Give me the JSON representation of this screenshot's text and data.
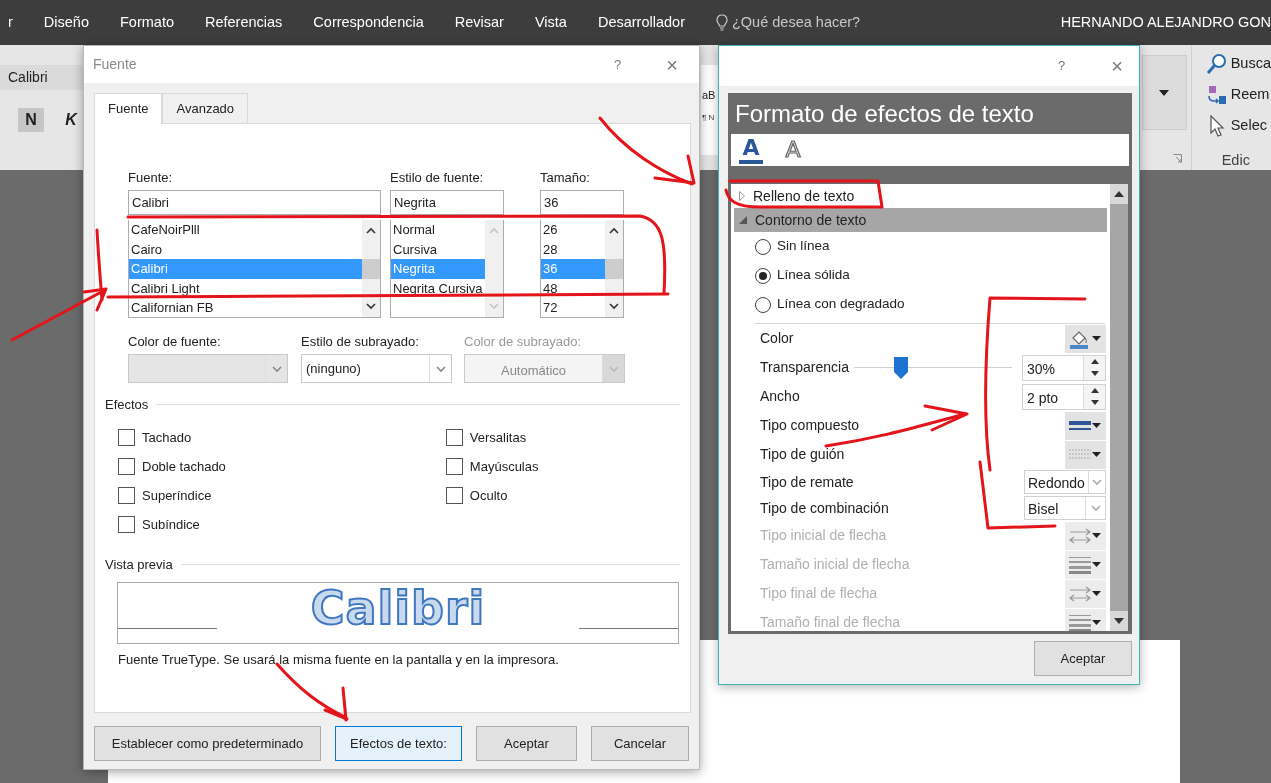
{
  "ribbon": {
    "tabs": [
      {
        "label": "r"
      },
      {
        "label": "Diseño"
      },
      {
        "label": "Formato"
      },
      {
        "label": "Referencias"
      },
      {
        "label": "Correspondencia"
      },
      {
        "label": "Revisar"
      },
      {
        "label": "Vista"
      },
      {
        "label": "Desarrollador"
      }
    ],
    "tell_me": {
      "placeholder": "¿Qué desea hacer?"
    },
    "user": "HERNANDO ALEJANDRO GON",
    "font_name": "Calibri",
    "bold": "N",
    "italic": "K",
    "styles_fragment": "aB",
    "paragraph_fragment": "¶ N",
    "editing": {
      "items": [
        {
          "kind": "find",
          "label": "Busca"
        },
        {
          "kind": "replace",
          "label": "Reem"
        },
        {
          "kind": "select",
          "label": "Selec"
        }
      ],
      "group_label": "Edic"
    }
  },
  "font_dialog": {
    "title": "Fuente",
    "help": "?",
    "close": "×",
    "tabs": [
      {
        "label": "Fuente",
        "selected": true
      },
      {
        "label": "Avanzado",
        "selected": false
      }
    ],
    "pickers": [
      {
        "label": "Fuente:",
        "value": "Calibri",
        "scrollbar_disabled": false,
        "items": [
          {
            "text": "CafeNoirPlll",
            "selected": false
          },
          {
            "text": "Cairo",
            "selected": false
          },
          {
            "text": "Calibri",
            "selected": true
          },
          {
            "text": "Calibri Light",
            "selected": false
          },
          {
            "text": "Californian FB",
            "selected": false
          }
        ]
      },
      {
        "label": "Estilo de fuente:",
        "value": "Negrita",
        "scrollbar_disabled": true,
        "items": [
          {
            "text": "Normal",
            "selected": false
          },
          {
            "text": "Cursiva",
            "selected": false
          },
          {
            "text": "Negrita",
            "selected": true
          },
          {
            "text": "Negrita Cursiva",
            "selected": false
          }
        ]
      },
      {
        "label": "Tamaño:",
        "value": "36",
        "scrollbar_disabled": false,
        "items": [
          {
            "text": "26",
            "selected": false
          },
          {
            "text": "28",
            "selected": false
          },
          {
            "text": "36",
            "selected": true
          },
          {
            "text": "48",
            "selected": false
          },
          {
            "text": "72",
            "selected": false
          }
        ]
      }
    ],
    "dropdowns": [
      {
        "kind": "color",
        "label": "Color de fuente:",
        "disabled": false
      },
      {
        "kind": "text",
        "label": "Estilo de subrayado:",
        "value": "(ninguno)",
        "disabled": false
      },
      {
        "kind": "text",
        "label": "Color de subrayado:",
        "value": "Automático",
        "disabled": true
      }
    ],
    "effects_heading": "Efectos",
    "effects_left": [
      {
        "label": "Tachado",
        "checked": false
      },
      {
        "label": "Doble tachado",
        "checked": false
      },
      {
        "label": "Superíndice",
        "checked": false
      },
      {
        "label": "Subíndice",
        "checked": false
      }
    ],
    "effects_right": [
      {
        "label": "Versalitas",
        "checked": false
      },
      {
        "label": "Mayúsculas",
        "checked": false
      },
      {
        "label": "Oculto",
        "checked": false
      }
    ],
    "preview_heading": "Vista previa",
    "preview_sample": "Calibri",
    "note": "Fuente TrueType. Se usará la misma fuente en la pantalla y en la impresora.",
    "buttons": [
      {
        "label": "Establecer como predeterminado",
        "focused": false
      },
      {
        "label": "Efectos de texto:",
        "focused": true
      },
      {
        "label": "Aceptar",
        "focused": false
      },
      {
        "label": "Cancelar",
        "focused": false
      }
    ]
  },
  "effects_dialog": {
    "help": "?",
    "close": "×",
    "heading": "Formato de efectos de texto",
    "icon_tabs": [
      {
        "kind": "fill",
        "glyph": "A",
        "selected": true
      },
      {
        "kind": "outline",
        "glyph": "A",
        "selected": false
      }
    ],
    "sections": [
      {
        "label": "Relleno de texto",
        "expanded": false
      },
      {
        "label": "Contorno de texto",
        "expanded": true,
        "options": [
          {
            "label": "Sin línea",
            "selected": false
          },
          {
            "label": "Línea sólida",
            "selected": true
          },
          {
            "label": "Línea con degradado",
            "selected": false
          }
        ],
        "properties": [
          {
            "kind": "color",
            "label": "Color",
            "disabled": false
          },
          {
            "kind": "slider",
            "label": "Transparencia",
            "level": 0.3,
            "value": "30%",
            "disabled": false
          },
          {
            "kind": "spin",
            "label": "Ancho",
            "value": "2 pto",
            "disabled": false
          },
          {
            "kind": "compound",
            "label": "Tipo compuesto",
            "disabled": false
          },
          {
            "kind": "dash",
            "label": "Tipo de guión",
            "disabled": false
          },
          {
            "kind": "select",
            "label": "Tipo de remate",
            "value": "Redondo",
            "disabled": false
          },
          {
            "kind": "select",
            "label": "Tipo de combinación",
            "value": "Bisel",
            "disabled": false
          },
          {
            "kind": "arrow_type",
            "label": "Tipo inicial de flecha",
            "disabled": true
          },
          {
            "kind": "arrow_size",
            "label": "Tamaño inicial de flecha",
            "disabled": true
          },
          {
            "kind": "arrow_type",
            "label": "Tipo final de flecha",
            "disabled": true
          },
          {
            "kind": "arrow_size",
            "label": "Tamaño final de flecha",
            "disabled": true
          }
        ]
      }
    ],
    "ok": "Aceptar"
  }
}
